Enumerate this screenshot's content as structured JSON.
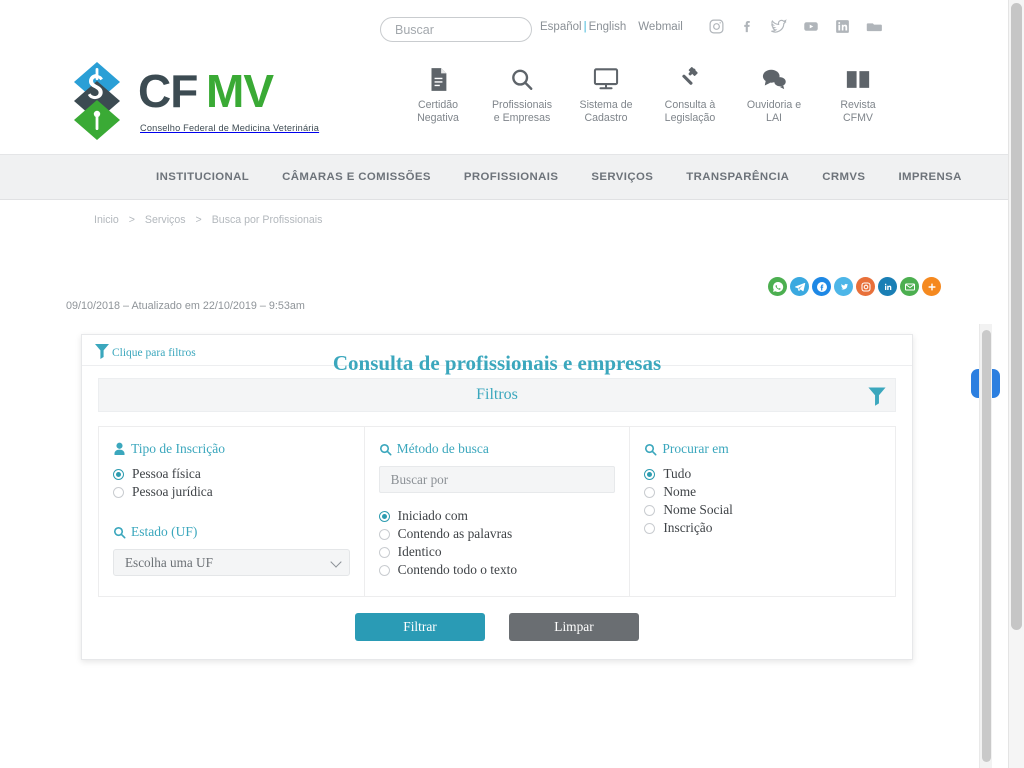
{
  "header": {
    "search": {
      "placeholder": "Buscar",
      "value": ""
    },
    "util_links": [
      {
        "label": "Español",
        "name": "lang-es"
      },
      {
        "label": "English",
        "name": "lang-en"
      },
      {
        "label": "Webmail",
        "name": "webmail"
      }
    ],
    "util_separator": "|",
    "social_top": [
      {
        "name": "instagram-icon",
        "label": "Instagram"
      },
      {
        "name": "facebook-icon",
        "label": "Facebook"
      },
      {
        "name": "twitter-icon",
        "label": "Twitter"
      },
      {
        "name": "youtube-icon",
        "label": "YouTube"
      },
      {
        "name": "linkedin-icon",
        "label": "LinkedIn"
      },
      {
        "name": "flickr-icon",
        "label": "Flickr"
      }
    ],
    "logo": {
      "text_cf": "CF",
      "text_m": "M",
      "text_v": "V",
      "subtitle": "Conselho Federal de Medicina Veterinária",
      "colors": {
        "blue": "#2a9fd6",
        "dark": "#3c4b52",
        "green": "#3aaa35",
        "mid_green": "#5aa84f"
      }
    },
    "quicknav": [
      {
        "icon": "document-icon",
        "label": "Certidão\nNegativa"
      },
      {
        "icon": "search-icon",
        "label": "Profissionais\ne Empresas"
      },
      {
        "icon": "monitor-icon",
        "label": "Sistema de\nCadastro"
      },
      {
        "icon": "gavel-icon",
        "label": "Consulta à\nLegislação"
      },
      {
        "icon": "chat-icon",
        "label": "Ouvidoria e\nLAI"
      },
      {
        "icon": "book-icon",
        "label": "Revista\nCFMV"
      }
    ]
  },
  "mainmenu": [
    {
      "label": "INSTITUCIONAL"
    },
    {
      "label": "CÂMARAS E COMISSÕES"
    },
    {
      "label": "PROFISSIONAIS"
    },
    {
      "label": "SERVIÇOS"
    },
    {
      "label": "TRANSPARÊNCIA"
    },
    {
      "label": "CRMVS"
    },
    {
      "label": "IMPRENSA"
    }
  ],
  "breadcrumb": {
    "items": [
      {
        "label": "Inicio"
      },
      {
        "label": "Serviços"
      },
      {
        "label": "Busca por Profissionais"
      }
    ],
    "separator": ">"
  },
  "share": [
    {
      "name": "whatsapp-share-icon",
      "color": "#4caf50",
      "glyph": "whatsapp"
    },
    {
      "name": "telegram-share-icon",
      "color": "#3aa9e0",
      "glyph": "telegram"
    },
    {
      "name": "facebook-share-icon",
      "color": "#1e88e5",
      "glyph": "facebook"
    },
    {
      "name": "twitter-share-icon",
      "color": "#4db6e8",
      "glyph": "twitter"
    },
    {
      "name": "instagram-share-icon",
      "color": "#e8703a",
      "glyph": "instagram"
    },
    {
      "name": "linkedin-share-icon",
      "color": "#1a7fb5",
      "glyph": "linkedin"
    },
    {
      "name": "email-share-icon",
      "color": "#4caf50",
      "glyph": "email"
    },
    {
      "name": "more-share-icon",
      "color": "#f5891f",
      "glyph": "plus"
    }
  ],
  "dateline": "09/10/2018 – Atualizado em 22/10/2019 – 9:53am",
  "panel": {
    "clique_label": "Clique para filtros",
    "title": "Consulta de profissionais e empresas",
    "filtros_label": "Filtros",
    "accent_color": "#3ba7bd",
    "col_tipo": {
      "heading": "Tipo de Inscrição",
      "heading_icon": "person-icon",
      "options": [
        {
          "label": "Pessoa física",
          "selected": true
        },
        {
          "label": "Pessoa jurídica",
          "selected": false
        }
      ],
      "uf_heading": "Estado (UF)",
      "uf_heading_icon": "search-icon",
      "uf_value": "Escolha uma UF"
    },
    "col_metodo": {
      "heading": "Método de busca",
      "heading_icon": "search-icon",
      "input_placeholder": "Buscar por",
      "input_value": "",
      "options": [
        {
          "label": "Iniciado com",
          "selected": true
        },
        {
          "label": "Contendo as palavras",
          "selected": false
        },
        {
          "label": "Identico",
          "selected": false
        },
        {
          "label": "Contendo todo o texto",
          "selected": false
        }
      ]
    },
    "col_procurar": {
      "heading": "Procurar em",
      "heading_icon": "search-icon",
      "options": [
        {
          "label": "Tudo",
          "selected": true
        },
        {
          "label": "Nome",
          "selected": false
        },
        {
          "label": "Nome Social",
          "selected": false
        },
        {
          "label": "Inscrição",
          "selected": false
        }
      ]
    },
    "buttons": {
      "filter_label": "Filtrar",
      "clear_label": "Limpar",
      "filter_color": "#2a9bb5",
      "clear_color": "#6a6e72"
    }
  },
  "floating_widget": {
    "name": "accessibility-widget",
    "color": "#2c7fe0",
    "icon": "hand-icon"
  }
}
